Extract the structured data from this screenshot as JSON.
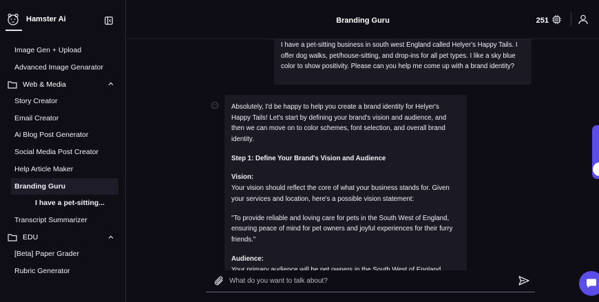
{
  "app": {
    "name": "Hamster Ai"
  },
  "sidebar": {
    "items": [
      {
        "type": "item",
        "label": "Image Gen + Upload"
      },
      {
        "type": "item",
        "label": "Advanced Image Genarator"
      },
      {
        "type": "group",
        "label": "Web & Media"
      },
      {
        "type": "item",
        "label": "Story Creator"
      },
      {
        "type": "item",
        "label": "Email Creator"
      },
      {
        "type": "item",
        "label": "Ai Blog Post Generator"
      },
      {
        "type": "item",
        "label": "Social Media Post Creator"
      },
      {
        "type": "item",
        "label": "Help Article Maker"
      },
      {
        "type": "item",
        "label": "Branding Guru",
        "active": true
      },
      {
        "type": "sub",
        "label": "I have a pet-sitting..."
      },
      {
        "type": "item",
        "label": "Transcript Summarizer"
      },
      {
        "type": "group",
        "label": "EDU"
      },
      {
        "type": "item",
        "label": "[Beta] Paper Grader"
      },
      {
        "type": "item",
        "label": "Rubric Generator"
      }
    ]
  },
  "header": {
    "title": "Branding Guru",
    "credits": "251"
  },
  "chat": {
    "user_message": "I have a pet-sitting business in south west England called Helyer's Happy Tails. I offer dog walks, pet/house-sitting, and drop-ins for all pet types. I like a sky blue color to show positivity. Please can you help me come up with a brand identity?",
    "bot_intro": "Absolutely, I'd be happy to help you create a brand identity for Helyer's Happy Tails! Let's start by defining your brand's vision and audience, and then we can move on to color schemes, font selection, and overall brand identity.",
    "step1_heading": "Step 1: Define Your Brand's Vision and Audience",
    "vision_heading": "Vision:",
    "vision_text": "Your vision should reflect the core of what your business stands for. Given your services and location, here's a possible vision statement:",
    "vision_statement": "\"To provide reliable and loving care for pets in the South West of England, ensuring peace of mind for pet owners and joyful experiences for their furry friends.\"",
    "audience_heading": "Audience:",
    "audience_text": "Your primary audience will be pet owners in the South West of England"
  },
  "composer": {
    "placeholder": "What do you want to talk about?"
  },
  "colors": {
    "accent": "#5b4ee8",
    "background": "#0e0d15",
    "bubble": "#1b1a24"
  }
}
